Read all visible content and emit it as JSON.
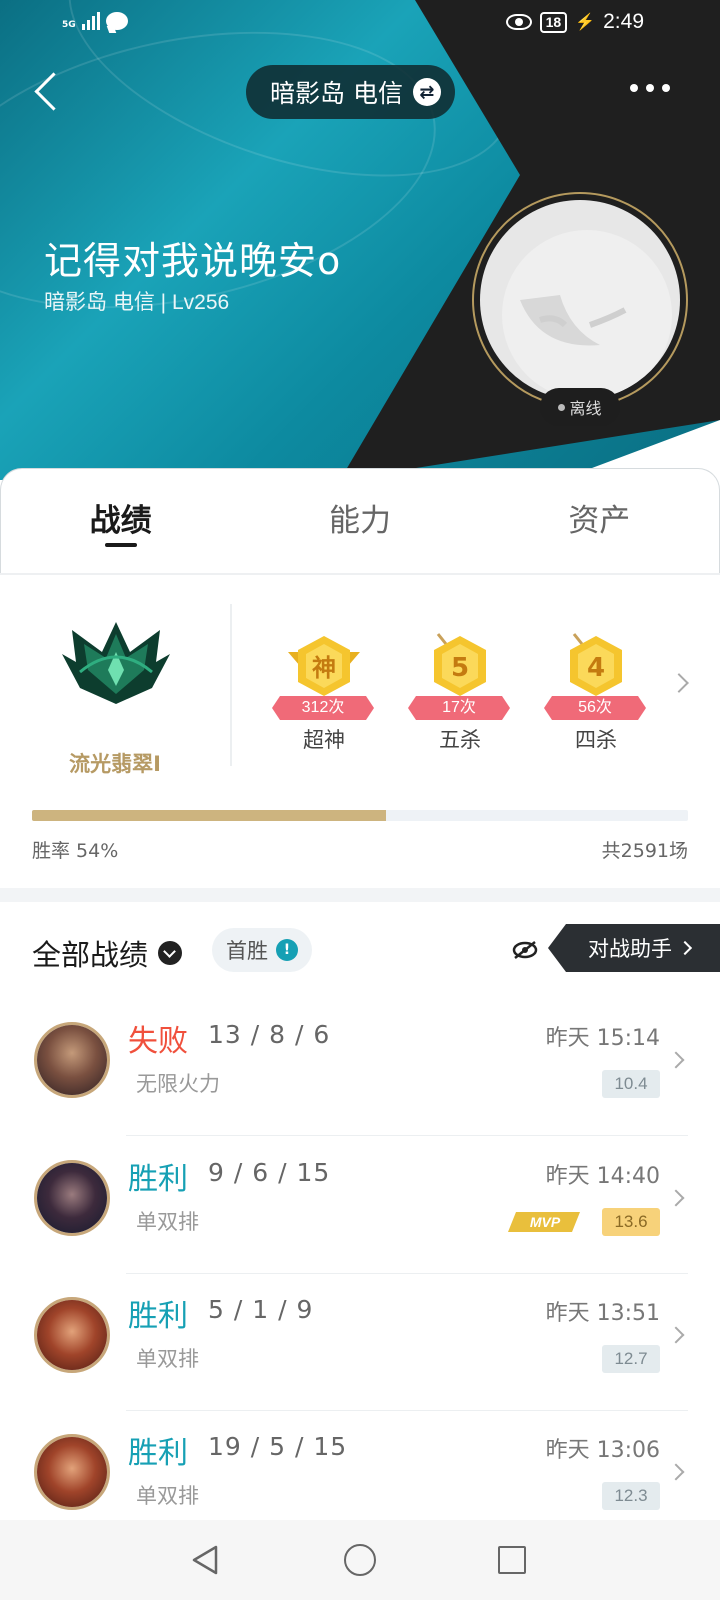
{
  "status_bar": {
    "signal_label": "5G",
    "battery": "18",
    "time": "2:49"
  },
  "header": {
    "server": "暗影岛 电信",
    "player_name": "记得对我说晚安o",
    "player_sub": "暗影岛 电信 | Lv256",
    "status": "离线"
  },
  "tabs": [
    {
      "label": "战绩",
      "active": true
    },
    {
      "label": "能力",
      "active": false
    },
    {
      "label": "资产",
      "active": false
    }
  ],
  "rank": {
    "name": "流光翡翠I",
    "icon": "emerald-rank-emblem-icon"
  },
  "badges": [
    {
      "glyph": "神",
      "count": "312次",
      "label": "超神"
    },
    {
      "glyph": "5",
      "count": "17次",
      "label": "五杀"
    },
    {
      "glyph": "4",
      "count": "56次",
      "label": "四杀"
    }
  ],
  "winrate": {
    "label": "胜率  54%",
    "value": 0.54,
    "total": "共2591场"
  },
  "filter": {
    "label": "全部战绩",
    "first_win": "首胜",
    "assistant": "对战助手"
  },
  "matches": [
    {
      "result": "失败",
      "outcome": "loss",
      "kda": "13 / 8 / 6",
      "mode": "无限火力",
      "time": "昨天 15:14",
      "score": "10.4",
      "mvp": false
    },
    {
      "result": "胜利",
      "outcome": "win",
      "kda": "9 / 6 / 15",
      "mode": "单双排",
      "time": "昨天 14:40",
      "score": "13.6",
      "mvp": true
    },
    {
      "result": "胜利",
      "outcome": "win",
      "kda": "5 / 1 / 9",
      "mode": "单双排",
      "time": "昨天 13:51",
      "score": "12.7",
      "mvp": false
    },
    {
      "result": "胜利",
      "outcome": "win",
      "kda": "19 / 5 / 15",
      "mode": "单双排",
      "time": "昨天 13:06",
      "score": "12.3",
      "mvp": false
    }
  ],
  "colors": {
    "accent": "#16a0b4",
    "loss": "#f0503c",
    "gold": "#cdb47f",
    "badge_red": "#f06a78"
  }
}
